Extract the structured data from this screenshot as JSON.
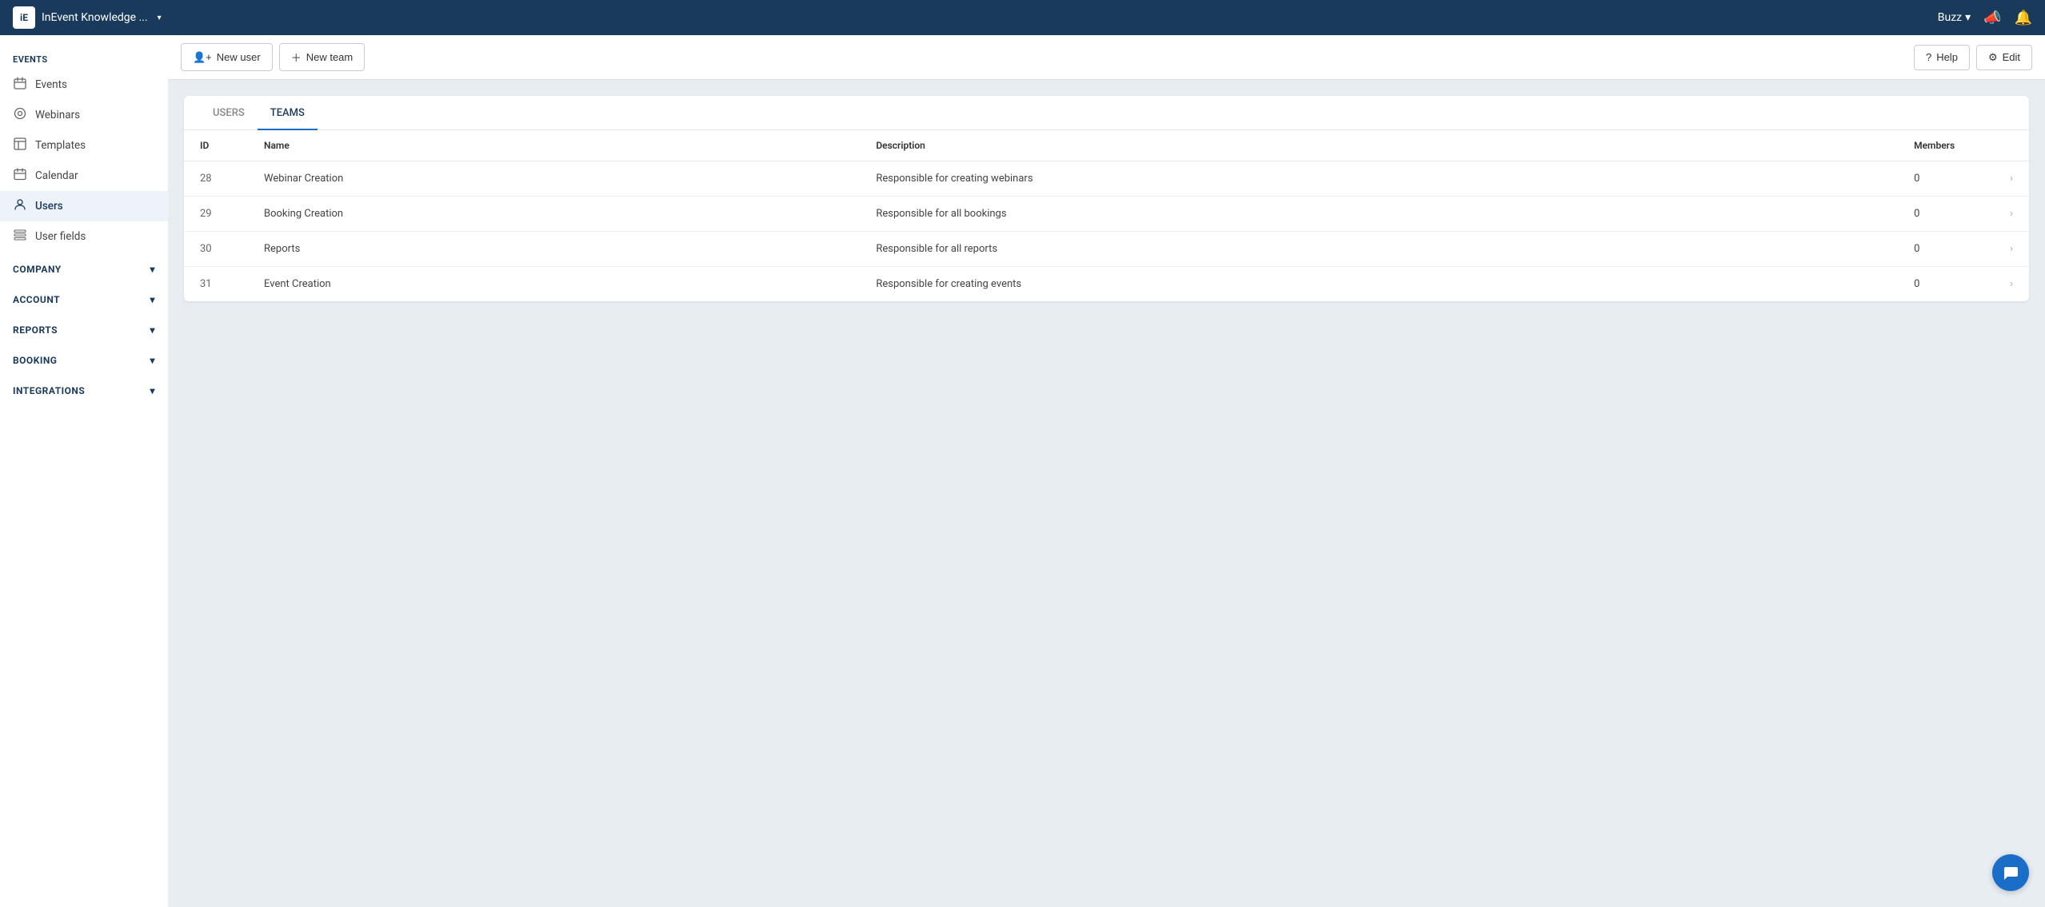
{
  "topnav": {
    "app_name": "InEvent Knowledge ...",
    "chevron": "▾",
    "buzz_label": "Buzz",
    "megaphone_icon": "📣",
    "bell_icon": "🔔"
  },
  "toolbar": {
    "new_user_label": "New user",
    "new_team_label": "New team",
    "help_label": "Help",
    "edit_label": "Edit"
  },
  "sidebar": {
    "events_section": "EVENTS",
    "nav_items": [
      {
        "id": "events",
        "label": "Events",
        "icon": "▤"
      },
      {
        "id": "webinars",
        "label": "Webinars",
        "icon": "◎"
      },
      {
        "id": "templates",
        "label": "Templates",
        "icon": "◈"
      },
      {
        "id": "calendar",
        "label": "Calendar",
        "icon": "▦"
      },
      {
        "id": "users",
        "label": "Users",
        "icon": "👤"
      },
      {
        "id": "user-fields",
        "label": "User fields",
        "icon": "▤"
      }
    ],
    "company_label": "COMPANY",
    "account_label": "ACCOUNT",
    "reports_label": "REPORTS",
    "booking_label": "BOOKING",
    "integrations_label": "INTEGRATIONS"
  },
  "tabs": [
    {
      "id": "users",
      "label": "USERS"
    },
    {
      "id": "teams",
      "label": "TEAMS"
    }
  ],
  "table": {
    "columns": [
      "ID",
      "Name",
      "Description",
      "Members"
    ],
    "rows": [
      {
        "id": "28",
        "name": "Webinar Creation",
        "description": "Responsible for creating webinars",
        "members": "0"
      },
      {
        "id": "29",
        "name": "Booking Creation",
        "description": "Responsible for all bookings",
        "members": "0"
      },
      {
        "id": "30",
        "name": "Reports",
        "description": "Responsible for all reports",
        "members": "0"
      },
      {
        "id": "31",
        "name": "Event Creation",
        "description": "Responsible for creating events",
        "members": "0"
      }
    ]
  }
}
